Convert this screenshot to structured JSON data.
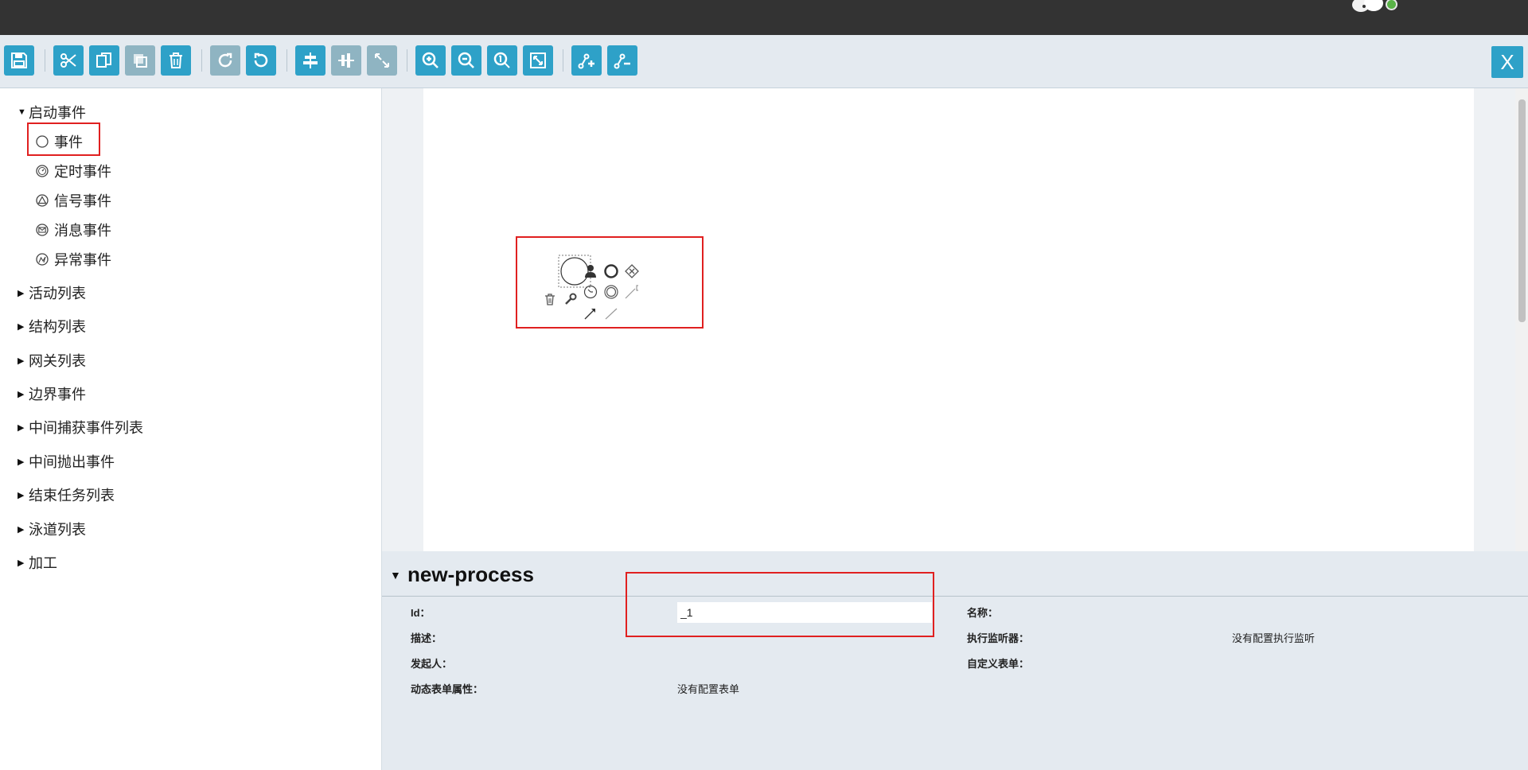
{
  "toolbar": {
    "close_label": "X"
  },
  "sidebar": {
    "categories": [
      {
        "label": "启动事件"
      },
      {
        "label": "活动列表"
      },
      {
        "label": "结构列表"
      },
      {
        "label": "网关列表"
      },
      {
        "label": "边界事件"
      },
      {
        "label": "中间捕获事件列表"
      },
      {
        "label": "中间抛出事件"
      },
      {
        "label": "结束任务列表"
      },
      {
        "label": "泳道列表"
      },
      {
        "label": "加工"
      }
    ],
    "start_events": [
      {
        "label": "事件",
        "icon": "circle-icon"
      },
      {
        "label": "定时事件",
        "icon": "timer-icon"
      },
      {
        "label": "信号事件",
        "icon": "signal-icon"
      },
      {
        "label": "消息事件",
        "icon": "message-icon"
      },
      {
        "label": "异常事件",
        "icon": "error-icon"
      }
    ]
  },
  "properties": {
    "title": "new-process",
    "id_label": "Id：",
    "id_value": "_1",
    "name_label": "名称：",
    "desc_label": "描述：",
    "listener_label": "执行监听器：",
    "listener_value": "没有配置执行监听",
    "initiator_label": "发起人：",
    "custom_form_label": "自定义表单：",
    "dynamic_form_label": "动态表单属性：",
    "dynamic_form_value": "没有配置表单"
  },
  "colors": {
    "accent": "#2ea1c8",
    "topbar": "#333333",
    "highlight": "#e02020"
  }
}
